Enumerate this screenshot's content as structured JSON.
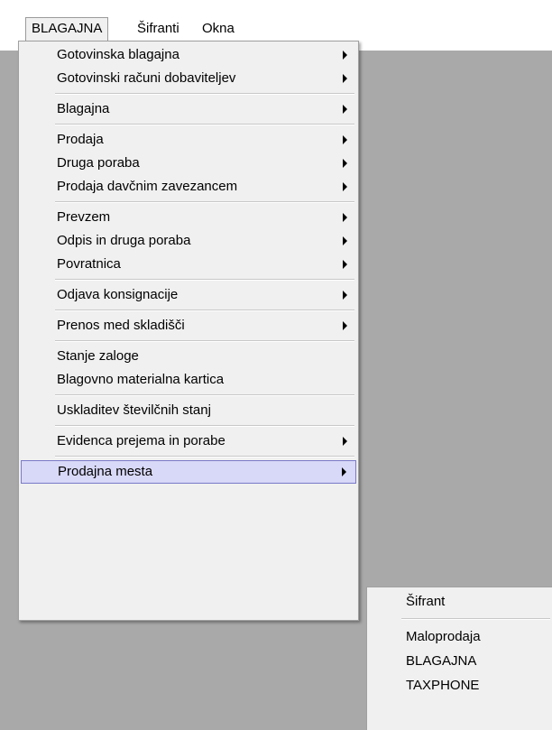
{
  "menubar": {
    "items": [
      {
        "label": "BLAGAJNA",
        "active": true
      },
      {
        "label": "Šifranti"
      },
      {
        "label": "Okna"
      }
    ]
  },
  "main_menu": {
    "groups": [
      [
        {
          "label": "Gotovinska blagajna",
          "submenu": true
        },
        {
          "label": "Gotovinski računi dobaviteljev",
          "submenu": true
        }
      ],
      [
        {
          "label": "Blagajna",
          "submenu": true
        }
      ],
      [
        {
          "label": "Prodaja",
          "submenu": true
        },
        {
          "label": "Druga poraba",
          "submenu": true
        },
        {
          "label": "Prodaja davčnim zavezancem",
          "submenu": true
        }
      ],
      [
        {
          "label": "Prevzem",
          "submenu": true
        },
        {
          "label": "Odpis in druga poraba",
          "submenu": true
        },
        {
          "label": "Povratnica",
          "submenu": true
        }
      ],
      [
        {
          "label": "Odjava konsignacije",
          "submenu": true
        }
      ],
      [
        {
          "label": "Prenos med skladišči",
          "submenu": true
        }
      ],
      [
        {
          "label": "Stanje zaloge",
          "submenu": false
        },
        {
          "label": "Blagovno materialna kartica",
          "submenu": false
        }
      ],
      [
        {
          "label": "Uskladitev številčnih stanj",
          "submenu": false
        }
      ],
      [
        {
          "label": "Evidenca prejema in porabe",
          "submenu": true
        }
      ],
      [
        {
          "label": "Prodajna mesta",
          "submenu": true,
          "highlighted": true
        }
      ]
    ]
  },
  "sub_menu": {
    "groups": [
      [
        {
          "label": "Šifrant"
        }
      ],
      [
        {
          "label": "Maloprodaja"
        },
        {
          "label": "BLAGAJNA"
        },
        {
          "label": "TAXPHONE"
        }
      ]
    ]
  },
  "colors": {
    "workspace": "#a9a9a9",
    "menu_bg": "#f0f0f0",
    "highlight_bg": "#d8d8f8",
    "highlight_border": "#7a7ac8"
  }
}
